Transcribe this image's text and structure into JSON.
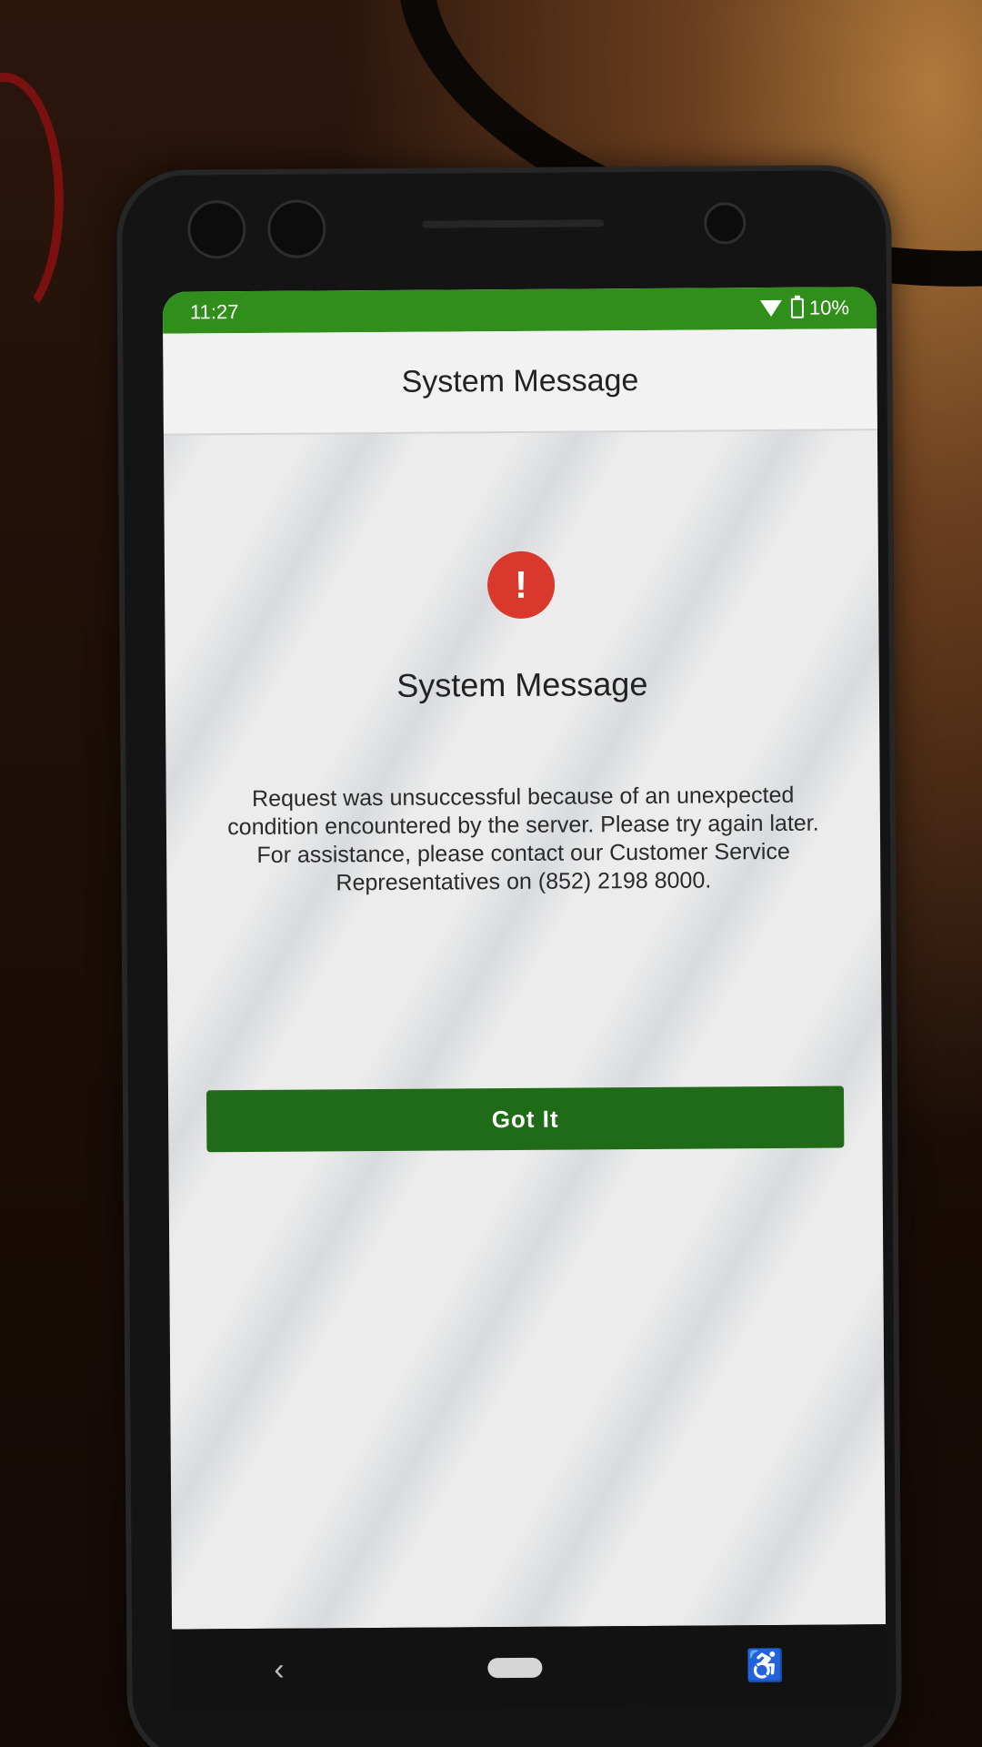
{
  "status_bar": {
    "time": "11:27",
    "battery": "10%",
    "wifi_icon": "wifi-icon",
    "battery_icon": "battery-icon",
    "color": "#2f8f1a"
  },
  "app_bar": {
    "title": "System Message"
  },
  "dialog": {
    "icon": "alert-icon",
    "icon_glyph": "!",
    "icon_color": "#d9382c",
    "title": "System Message",
    "body": "Request was unsuccessful because of an unexpected condition encountered by the server. Please try again later. For assistance, please contact our Customer Service Representatives on (852) 2198 8000.",
    "button_label": "Got It",
    "button_color": "#1f6b17"
  },
  "nav_bar": {
    "back_glyph": "‹",
    "accessibility_glyph": "♿",
    "icons": [
      "back-icon",
      "home-pill-icon",
      "accessibility-icon"
    ]
  }
}
